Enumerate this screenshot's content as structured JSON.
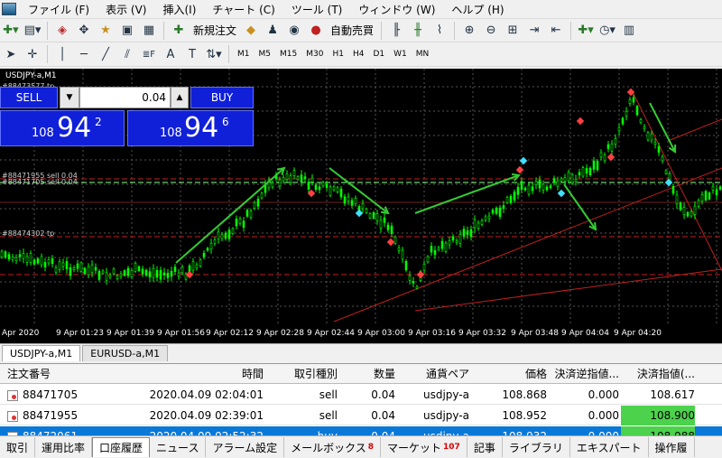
{
  "menu": [
    "ファイル (F)",
    "表示 (V)",
    "挿入(I)",
    "チャート (C)",
    "ツール (T)",
    "ウィンドウ (W)",
    "ヘルプ (H)"
  ],
  "toolbar1": {
    "new_order": "新規注文",
    "auto_trading": "自動売買"
  },
  "timeframes": [
    "M1",
    "M5",
    "M15",
    "M30",
    "H1",
    "H4",
    "D1",
    "W1",
    "MN"
  ],
  "chart": {
    "symbol_label": "USDJPY-a,M1",
    "order_label_top": "#88473577 tp",
    "order_label_mid": "#88471955 sell 0.04",
    "order_label_mid2": "#88471705 sell 0.04",
    "order_label_low": "#88474302 tp",
    "time_labels": [
      "Apr 2020",
      "9 Apr 01:23",
      "9 Apr 01:39",
      "9 Apr 01:56",
      "9 Apr 02:12",
      "9 Apr 02:28",
      "9 Apr 02:44",
      "9 Apr 03:00",
      "9 Apr 03:16",
      "9 Apr 03:32",
      "9 Apr 03:48",
      "9 Apr 04:04",
      "9 Apr 04:20"
    ],
    "background_color": "#000000",
    "candle_color": "#00ff00",
    "trend_arrow_color": "#33cc33",
    "level_line_color": "#c02020"
  },
  "trade_panel": {
    "sell_label": "SELL",
    "buy_label": "BUY",
    "lot": "0.04",
    "sell_prefix": "108",
    "sell_big": "94",
    "sell_sup": "2",
    "buy_prefix": "108",
    "buy_big": "94",
    "buy_sup": "6"
  },
  "chart_tabs": [
    "USDJPY-a,M1",
    "EURUSD-a,M1"
  ],
  "table": {
    "headers": [
      "注文番号",
      "時間",
      "取引種別",
      "数量",
      "通貨ペア",
      "価格",
      "決済逆指値...",
      "決済指値(..."
    ],
    "rows": [
      {
        "id": "88471705",
        "time": "2020.04.09 02:04:01",
        "type": "sell",
        "qty": "0.04",
        "pair": "usdjpy-a",
        "price": "108.868",
        "sl": "0.000",
        "tp": "108.617"
      },
      {
        "id": "88471955",
        "time": "2020.04.09 02:39:01",
        "type": "sell",
        "qty": "0.04",
        "pair": "usdjpy-a",
        "price": "108.952",
        "sl": "0.000",
        "tp": "108.900"
      },
      {
        "id": "88472061",
        "time": "2020.04.09 02:52:32",
        "type": "buy",
        "qty": "0.04",
        "pair": "usdjpy-a",
        "price": "108.932",
        "sl": "0.000",
        "tp": "108.988"
      }
    ]
  },
  "bottom_tabs": {
    "trade": "取引",
    "exposure": "運用比率",
    "history": "口座履歴",
    "news": "ニュース",
    "alerts": "アラーム設定",
    "mailbox": "メールボックス",
    "mailbox_badge": "8",
    "market": "マーケット",
    "market_badge": "107",
    "articles": "記事",
    "library": "ライブラリ",
    "experts": "エキスパート",
    "journal": "操作履"
  }
}
